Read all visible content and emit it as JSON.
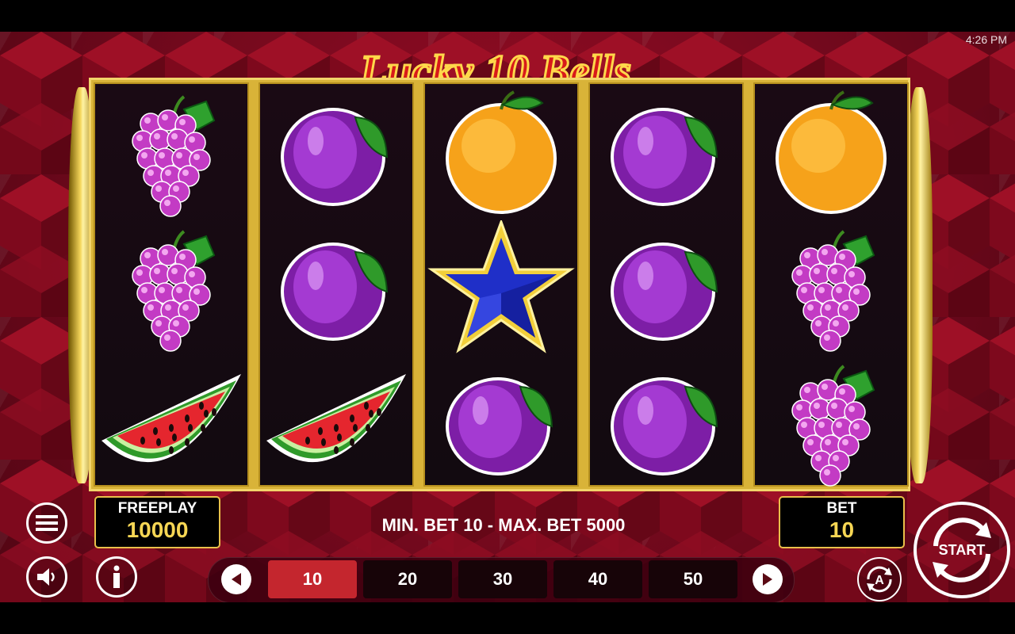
{
  "status_bar": {
    "time": "4:26 PM"
  },
  "game": {
    "title": "Lucky 10 Bells"
  },
  "reels": [
    [
      "grapes",
      "grapes",
      "watermelon"
    ],
    [
      "plum",
      "plum",
      "watermelon"
    ],
    [
      "orange",
      "star",
      "plum"
    ],
    [
      "plum",
      "plum",
      "plum"
    ],
    [
      "orange",
      "grapes",
      "grapes"
    ]
  ],
  "hud": {
    "freeplay_label": "FREEPLAY",
    "freeplay_value": "10000",
    "limits_text": "MIN. BET 10 - MAX. BET 5000",
    "bet_label": "BET",
    "bet_value": "10",
    "start_label": "START",
    "bet_options": [
      "10",
      "20",
      "30",
      "40",
      "50"
    ],
    "selected_bet": "10"
  },
  "icons": {
    "menu": "menu-icon",
    "sound": "speaker-icon",
    "info": "info-icon",
    "prev": "chevron-left-icon",
    "next": "chevron-right-icon",
    "autoplay": "autoplay-icon",
    "start": "start-icon"
  },
  "colors": {
    "background": "#8a0c22",
    "gold": "#e9c04a",
    "selected_chip": "#c4262e",
    "value_yellow": "#f6d654"
  }
}
